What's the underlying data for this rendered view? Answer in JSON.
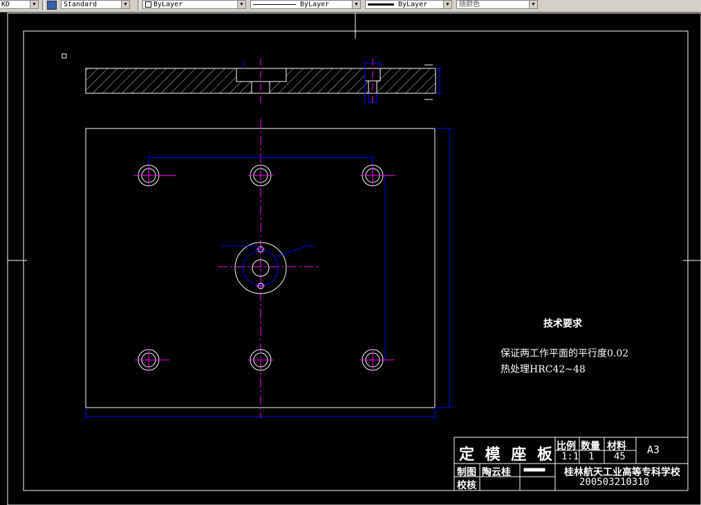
{
  "toolbar": {
    "first_combo": "KD",
    "text_style": "Standard",
    "layer": "ByLayer",
    "linetype": "ByLayer",
    "lineweight": "ByLayer",
    "color": "随颜色"
  },
  "tech": {
    "heading": "技术要求",
    "line1": "保证两工作平面的平行度0.02",
    "line2": "热处理HRC42~48"
  },
  "title_block": {
    "part_name": "定 模 座 板",
    "scale_label": "比例",
    "qty_label": "数量",
    "material_label": "材料",
    "sheet_size": "A3",
    "scale": "1:1",
    "qty": "1",
    "material": "45",
    "drawn_label": "制图",
    "drawn_by": "陶云桂",
    "checked_label": "校核",
    "school": "桂林航天工业高等专科学校",
    "drawing_no": "200503210310"
  }
}
